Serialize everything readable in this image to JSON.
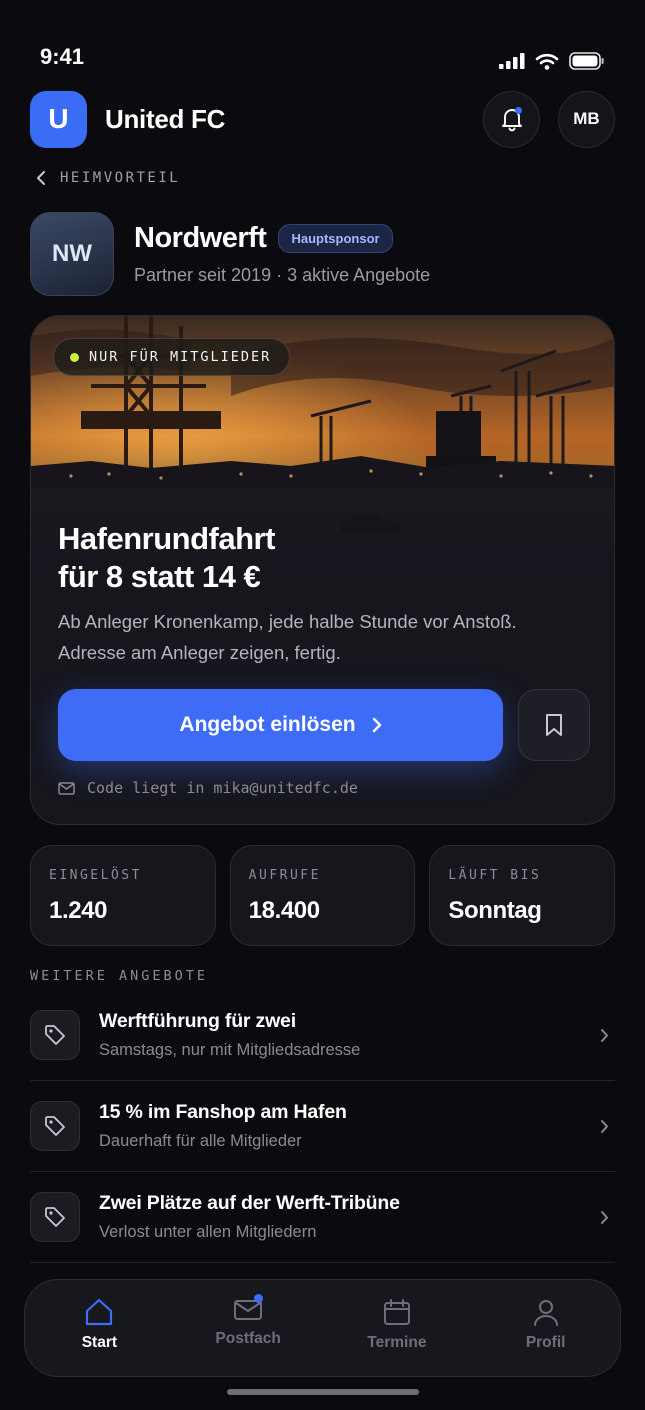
{
  "status_bar": {
    "time": "9:41"
  },
  "header": {
    "logo_letter": "U",
    "title": "United FC",
    "avatar_initials": "MB"
  },
  "breadcrumb": {
    "label": "HEIMVORTEIL"
  },
  "partner": {
    "logo_text": "NW",
    "name": "Nordwerft",
    "badge": "Hauptsponsor",
    "subtitle": "Partner seit 2019 · 3 aktive Angebote"
  },
  "offer": {
    "tag": "NUR FÜR MITGLIEDER",
    "title_line1": "Hafenrundfahrt",
    "title_line2": "für 8 statt 14 €",
    "desc_line1": "Ab Anleger Kronenkamp, jede halbe Stunde vor Anstoß.",
    "desc_line2": "Adresse am Anleger zeigen, fertig.",
    "cta_label": "Angebot einlösen",
    "code_note": "Code liegt in mika@unitedfc.de"
  },
  "stats": [
    {
      "label": "EINGELÖST",
      "value": "1.240"
    },
    {
      "label": "AUFRUFE",
      "value": "18.400"
    },
    {
      "label": "LÄUFT BIS",
      "value": "Sonntag"
    }
  ],
  "more_offers": {
    "title": "WEITERE ANGEBOTE",
    "items": [
      {
        "title": "Werftführung für zwei",
        "subtitle": "Samstags, nur mit Mitgliedsadresse"
      },
      {
        "title": "15 % im Fanshop am Hafen",
        "subtitle": "Dauerhaft für alle Mitglieder"
      },
      {
        "title": "Zwei Plätze auf der Werft-Tribüne",
        "subtitle": "Verlost unter allen Mitgliedern"
      }
    ]
  },
  "tabs": [
    {
      "label": "Start",
      "icon": "home-icon",
      "active": true
    },
    {
      "label": "Postfach",
      "icon": "mail-icon",
      "badge": true
    },
    {
      "label": "Termine",
      "icon": "calendar-icon"
    },
    {
      "label": "Profil",
      "icon": "user-icon"
    }
  ],
  "colors": {
    "accent": "#3e6cf7",
    "background": "#0b0b0f",
    "live_dot": "#c8f03c"
  }
}
